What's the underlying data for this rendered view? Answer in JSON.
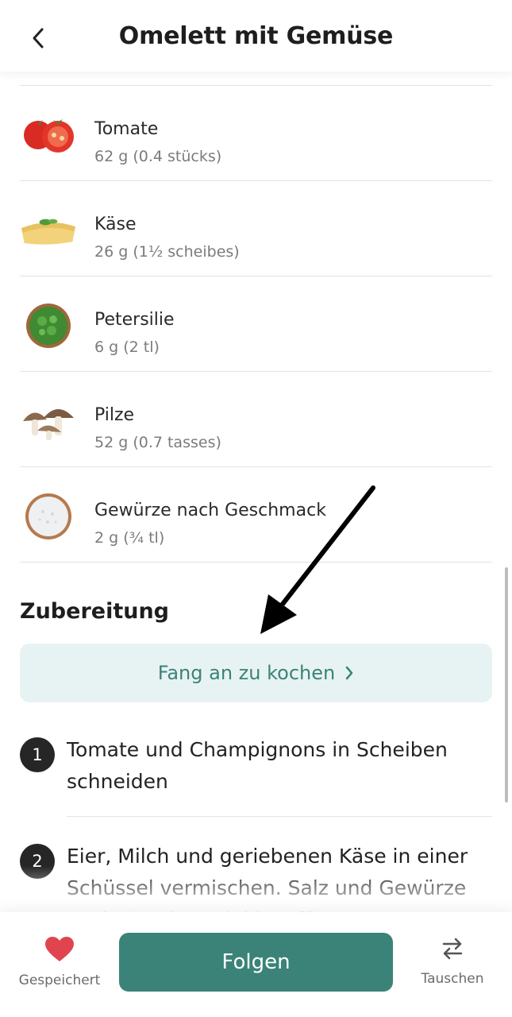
{
  "header": {
    "title": "Omelett mit Gemüse",
    "back_icon": "chevron-left-icon"
  },
  "ingredients": [
    {
      "name": "Tomate",
      "amount": "62 g (0.4 stücks)",
      "icon": "tomato-icon"
    },
    {
      "name": "Käse",
      "amount": "26 g (1½ scheibes)",
      "icon": "cheese-icon"
    },
    {
      "name": "Petersilie",
      "amount": "6 g (2 tl)",
      "icon": "parsley-icon"
    },
    {
      "name": "Pilze",
      "amount": "52 g (0.7 tasses)",
      "icon": "mushroom-icon"
    },
    {
      "name": "Gewürze nach Geschmack",
      "amount": "2 g (¾ tl)",
      "icon": "salt-icon"
    }
  ],
  "preparation": {
    "title": "Zubereitung",
    "cook_button": "Fang an zu kochen",
    "steps": [
      {
        "num": "1",
        "text": "Tomate und Champignons in Scheiben schneiden"
      },
      {
        "num": "2",
        "text": "Eier, Milch und geriebenen Käse in einer Schüssel vermischen. Salz und Gewürze nach Geschmack hinzufügen."
      }
    ]
  },
  "bottom": {
    "saved_label": "Gespeichert",
    "follow_label": "Folgen",
    "swap_label": "Tauschen"
  },
  "colors": {
    "accent": "#3b8378",
    "accent_light": "#e7f3f2",
    "heart": "#e0454f"
  }
}
